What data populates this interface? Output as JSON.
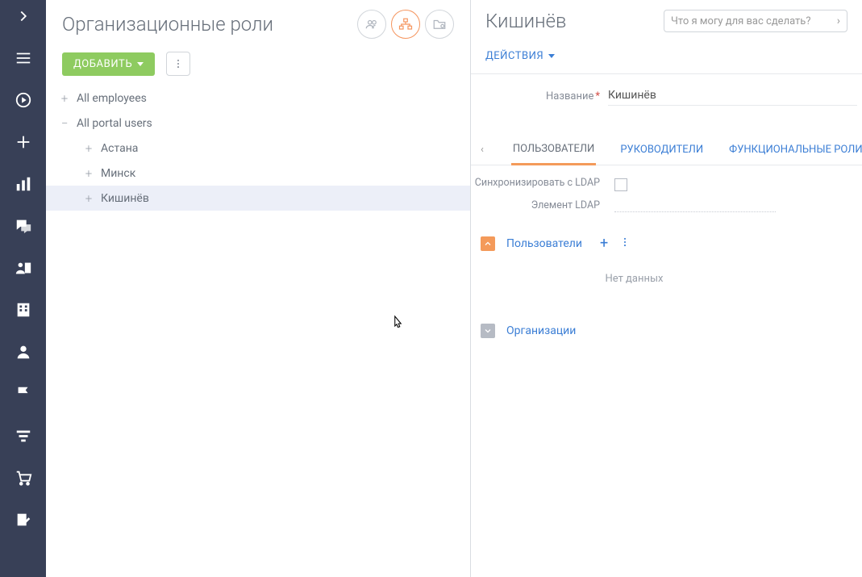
{
  "left": {
    "title": "Организационные роли",
    "add_label": "ДОБАВИТЬ",
    "tree": {
      "n0": "All employees",
      "n1": "All portal users",
      "n1_0": "Астана",
      "n1_1": "Минск",
      "n1_2": "Кишинёв"
    }
  },
  "right": {
    "title": "Кишинёв",
    "search_placeholder": "Что я могу для вас сделать?",
    "actions_label": "ДЕЙСТВИЯ",
    "name_label": "Название",
    "name_value": "Кишинёв",
    "tabs": {
      "t0": "ПОЛЬЗОВАТЕЛИ",
      "t1": "РУКОВОДИТЕЛИ",
      "t2": "ФУНКЦИОНАЛЬНЫЕ РОЛИ"
    },
    "ldap_sync_label": "Синхронизировать с LDAP",
    "ldap_element_label": "Элемент LDAP",
    "sections": {
      "users": "Пользователи",
      "orgs": "Организации"
    },
    "no_data": "Нет данных"
  },
  "colors": {
    "nav": "#384057",
    "accent": "#f49a5a",
    "primary": "#3b7ed5",
    "success": "#8ecb60"
  }
}
